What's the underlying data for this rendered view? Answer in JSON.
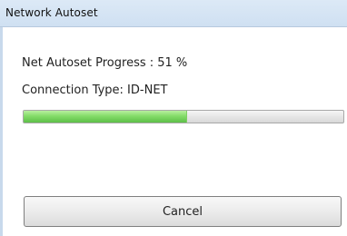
{
  "window": {
    "title": "Network Autoset"
  },
  "status": {
    "progress_label": "Net Autoset Progress : 51 %",
    "connection_label": "Connection Type: ID-NET",
    "progress_value": 51
  },
  "actions": {
    "cancel_label": "Cancel"
  }
}
